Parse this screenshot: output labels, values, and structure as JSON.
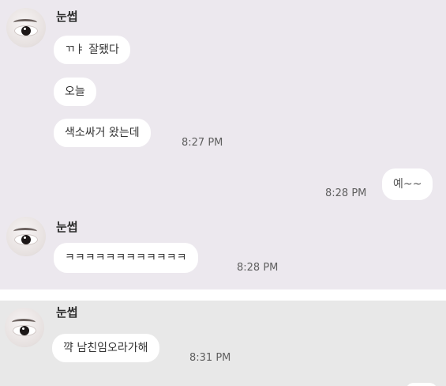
{
  "chat": {
    "group1": {
      "sender": "눈썹",
      "messages": [
        "ㄲㅑ 잘됐다",
        "오늘",
        "색소싸거 왔는데"
      ],
      "time": "8:27 PM"
    },
    "reply1": {
      "text": "예~~",
      "time": "8:28 PM"
    },
    "group2": {
      "sender": "눈썹",
      "message": "ㅋㅋㅋㅋㅋㅋㅋㅋㅋㅋㅋㅋ",
      "time": "8:28 PM"
    },
    "group3": {
      "sender": "눈썹",
      "message": "꺅 남친임오라가해",
      "time": "8:31 PM"
    }
  },
  "colors": {
    "panel1_bg": "#ece8ee",
    "panel2_bg": "#e8e8e8",
    "bubble_bg": "#ffffff"
  },
  "icons": {
    "avatar": "eye-avatar-icon"
  }
}
